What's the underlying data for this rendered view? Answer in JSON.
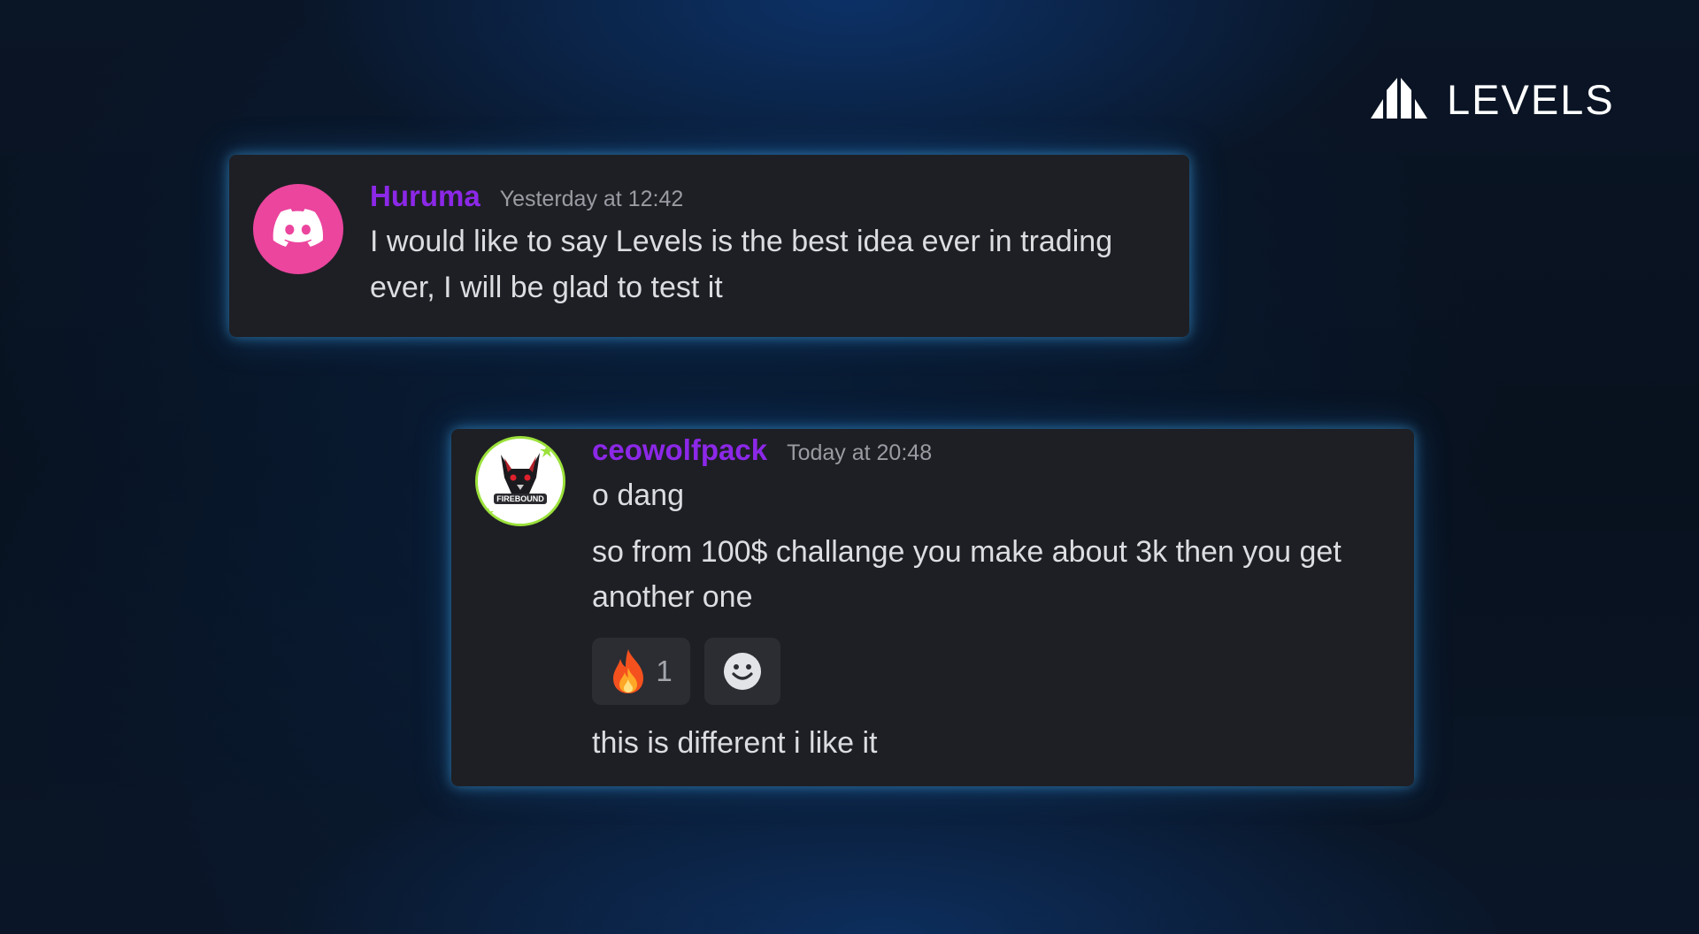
{
  "brand": {
    "name": "LEVELS",
    "logo_icon": "levels-peaks-icon"
  },
  "messages": [
    {
      "username": "Huruma",
      "timestamp": "Yesterday at 12:42",
      "avatar": "discord-logo-icon",
      "avatar_color": "#eb459e",
      "lines": [
        "I would like to say Levels is the best idea ever in trading",
        "ever, I will be glad to test it"
      ]
    },
    {
      "username": "ceowolfpack",
      "timestamp": "Today at 20:48",
      "avatar": "wolf-avatar-icon",
      "avatar_text": "FIREBOUND",
      "lines": [
        "o dang",
        "so from 100$ challange you make about 3k then you get",
        "another one"
      ],
      "reactions": [
        {
          "emoji": "fire-emoji-icon",
          "count": "1"
        },
        {
          "emoji": "add-reaction-smiley-icon"
        }
      ],
      "followup": "this is different i like it"
    }
  ],
  "colors": {
    "username": "#8c28e8",
    "timestamp": "#9a9ba3",
    "message_text": "#dcdde1",
    "card_background": "#1e1f24",
    "card_glow": "#46aff0"
  }
}
